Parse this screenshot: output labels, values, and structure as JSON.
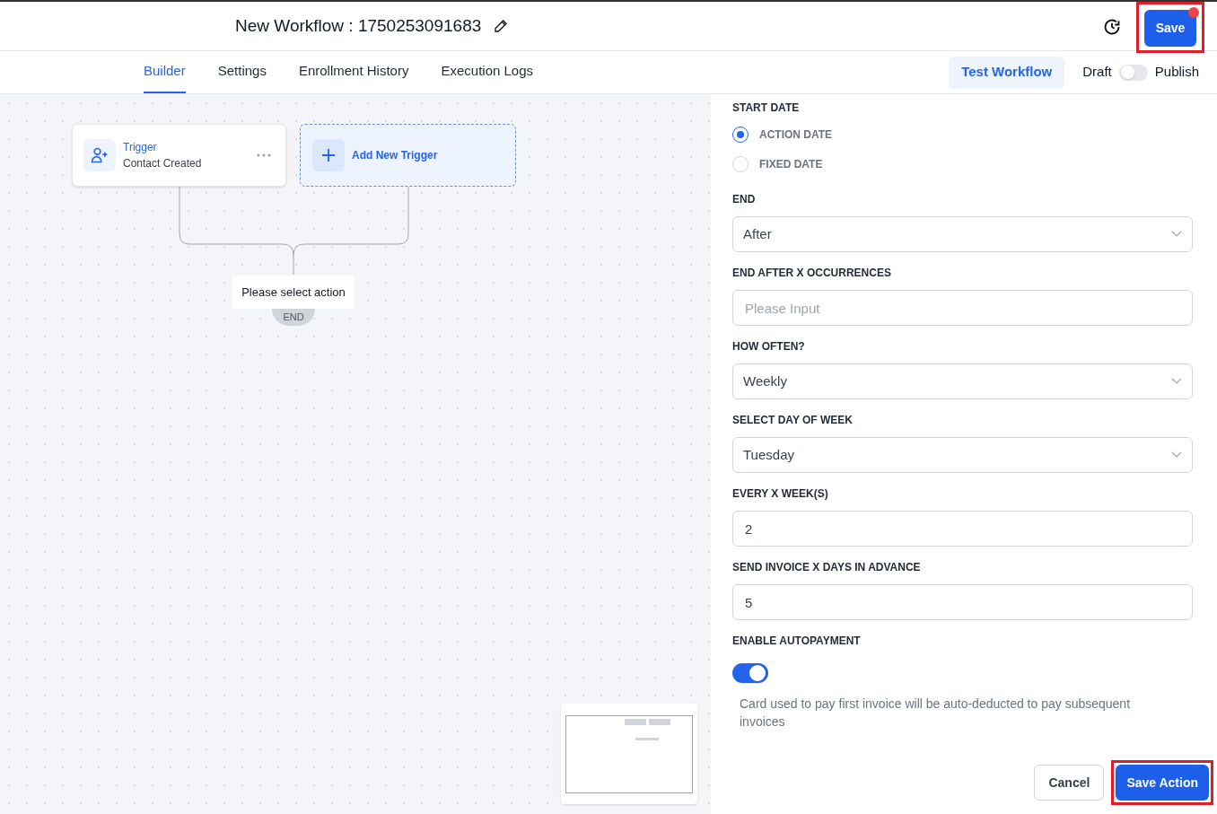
{
  "header": {
    "title": "New Workflow : 1750253091683",
    "save_button": "Save",
    "save_notification": true,
    "save_highlighted": true
  },
  "tabs": [
    {
      "label": "Builder",
      "selected": true
    },
    {
      "label": "Settings",
      "selected": false
    },
    {
      "label": "Enrollment History",
      "selected": false
    },
    {
      "label": "Execution Logs",
      "selected": false
    }
  ],
  "test_button": "Test Workflow",
  "publish_toggle": {
    "left_label": "Draft",
    "right_label": "Publish",
    "on": false
  },
  "canvas": {
    "trigger": {
      "title": "Trigger",
      "subtitle": "Contact Created"
    },
    "add_trigger": "Add New Trigger",
    "action_placeholder": "Please select action",
    "end_label": "END"
  },
  "form": {
    "fields": [
      {
        "kind": "radio",
        "label": "START DATE",
        "options": [
          {
            "label": "ACTION DATE",
            "selected": true
          },
          {
            "label": "FIXED DATE",
            "selected": false
          }
        ]
      },
      {
        "kind": "select",
        "label": "END",
        "value": "After"
      },
      {
        "kind": "input",
        "label": "END AFTER X OCCURRENCES",
        "placeholder": "Please Input"
      },
      {
        "kind": "select",
        "label": "HOW OFTEN?",
        "value": "Weekly"
      },
      {
        "kind": "select",
        "label": "SELECT DAY OF WEEK",
        "value": "Tuesday"
      },
      {
        "kind": "input",
        "label": "EVERY X WEEK(S)",
        "value": "2"
      },
      {
        "kind": "input",
        "label": "SEND INVOICE X DAYS IN ADVANCE",
        "value": "5"
      },
      {
        "kind": "toggle",
        "label": "ENABLE AUTOPAYMENT",
        "on": true,
        "help": "Card used to pay first invoice will be auto-deducted to pay subsequent invoices"
      }
    ]
  },
  "footer": {
    "cancel": "Cancel",
    "save": "Save Action",
    "save_highlighted": true
  }
}
